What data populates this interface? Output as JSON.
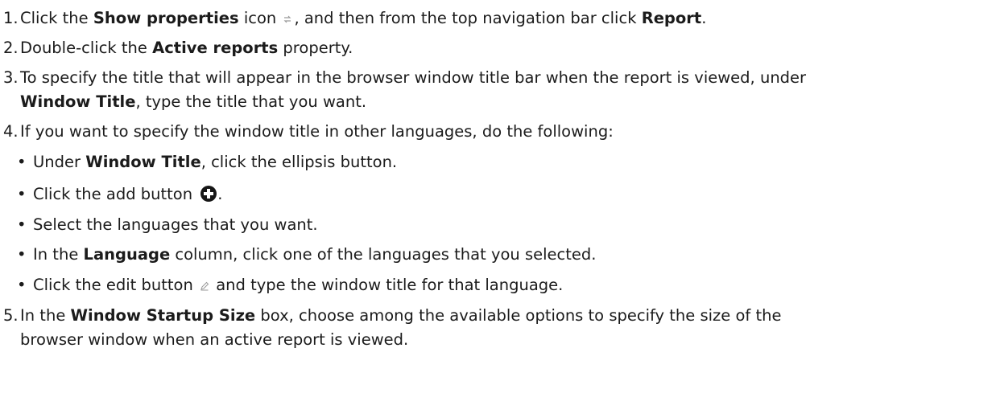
{
  "steps": [
    {
      "number": "1.",
      "pre": "Click the ",
      "bold1": "Show properties",
      "mid": " icon ",
      "icon": "show-properties-icon",
      "post": ", and then from the top navigation bar click ",
      "bold2": "Report",
      "end": "."
    },
    {
      "number": "2.",
      "pre": "Double-click the ",
      "bold1": "Active reports",
      "post": " property."
    },
    {
      "number": "3.",
      "line1": "To specify the title that will appear in the browser window title bar when the report is viewed, under",
      "bold1": "Window Title",
      "post": ", type the title that you want."
    },
    {
      "number": "4.",
      "text": "If you want to specify the window title in other languages, do the following:"
    },
    {
      "number": "5.",
      "pre": "In the ",
      "bold1": "Window Startup Size",
      "post": " box, choose among the available options to specify the size of the",
      "line2": "browser window when an active report is viewed."
    }
  ],
  "substeps": [
    {
      "bullet": "•",
      "pre": "Under ",
      "bold": "Window Title",
      "post": ", click the ellipsis button."
    },
    {
      "bullet": "•",
      "pre": "Click the add button ",
      "icon": "add-icon",
      "post": "."
    },
    {
      "bullet": "•",
      "text": "Select the languages that you want."
    },
    {
      "bullet": "•",
      "pre": "In the ",
      "bold": "Language",
      "post": " column, click one of the languages that you selected."
    },
    {
      "bullet": "•",
      "pre": "Click the edit button ",
      "icon": "edit-icon",
      "post": " and type the window title for that language."
    }
  ],
  "colors": {
    "text": "#1b1b1b",
    "icon_light": "#9a9a9a",
    "icon_dark": "#161616"
  }
}
